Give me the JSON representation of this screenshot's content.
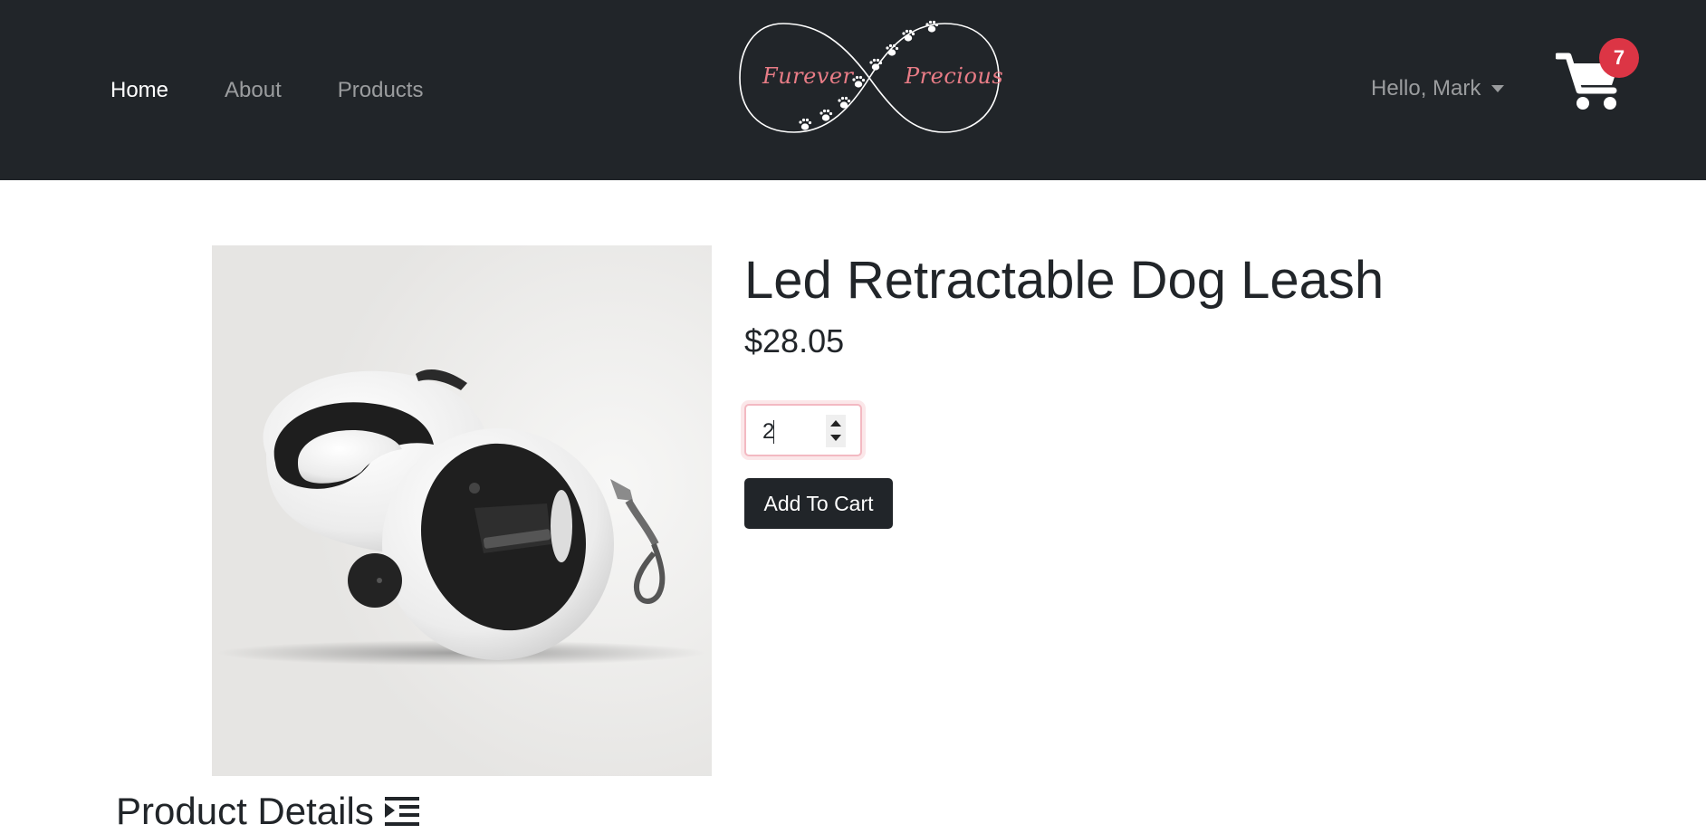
{
  "nav": {
    "links": [
      {
        "label": "Home",
        "active": true
      },
      {
        "label": "About",
        "active": false
      },
      {
        "label": "Products",
        "active": false
      }
    ],
    "logo": {
      "left_text": "Furever",
      "right_text": "Precious"
    },
    "user_greeting": "Hello, Mark",
    "cart_count": "7",
    "colors": {
      "background": "#212529",
      "badge": "#dc3545",
      "logo_text": "#e87c86"
    }
  },
  "product": {
    "title": "Led Retractable Dog Leash",
    "price": "$28.05",
    "quantity": "2",
    "add_to_cart_label": "Add To Cart",
    "image_icon": "retractable-leash-image"
  },
  "details": {
    "heading": "Product Details",
    "icon": "indent-list-icon"
  }
}
